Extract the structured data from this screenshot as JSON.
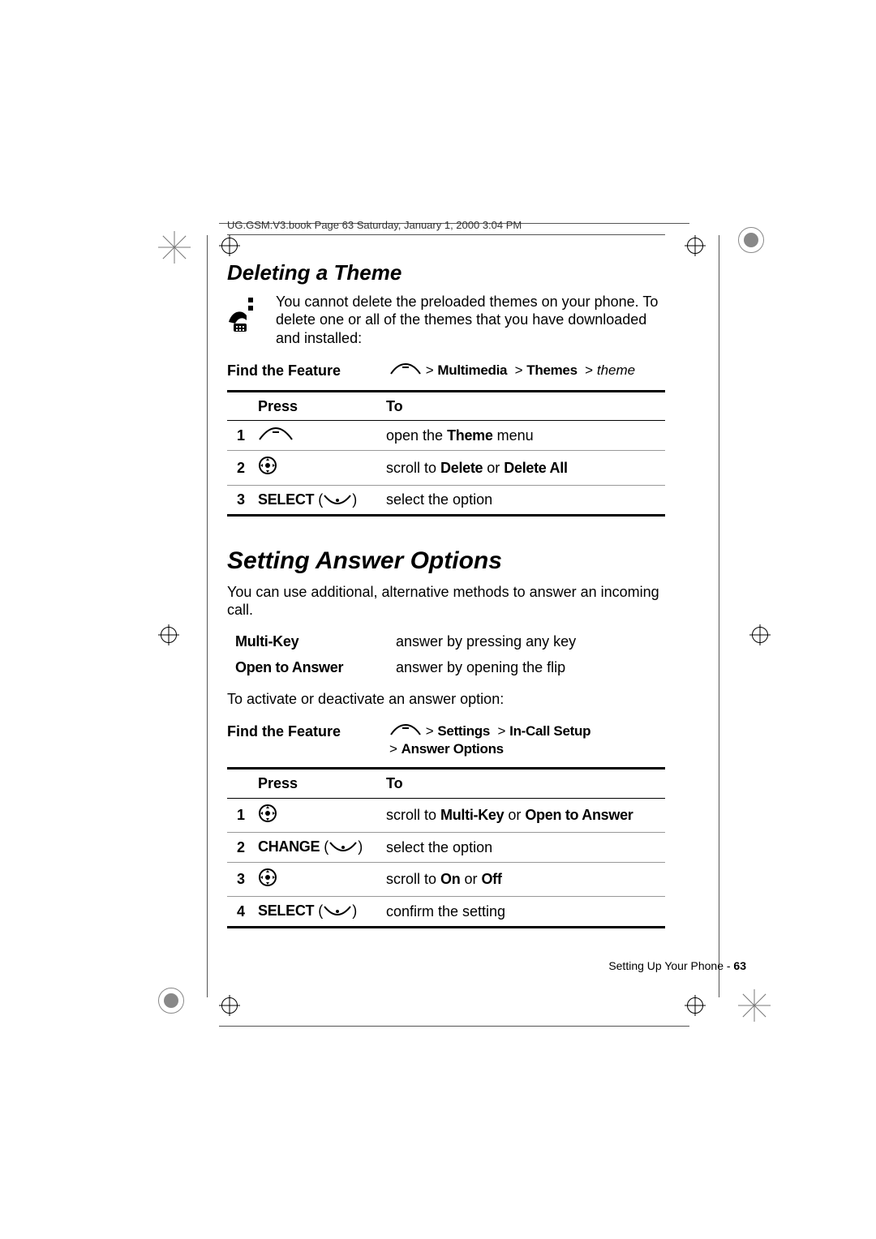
{
  "header": "UG.GSM.V3.book  Page 63  Saturday, January 1, 2000  3:04 PM",
  "section1": {
    "title": "Deleting a Theme",
    "intro": "You cannot delete the preloaded themes on your phone. To delete one or all of the themes that you have downloaded and installed:",
    "feature_label": "Find the Feature",
    "path_parts": {
      "a": "Multimedia",
      "b": "Themes",
      "c": "theme"
    },
    "table": {
      "head_press": "Press",
      "head_to": "To",
      "rows": [
        {
          "n": "1",
          "press_icon": "menu",
          "to_pre": "open the ",
          "to_b": "Theme",
          "to_post": " menu"
        },
        {
          "n": "2",
          "press_icon": "nav",
          "to_pre": "scroll to ",
          "to_b": "Delete",
          "to_mid": " or ",
          "to_b2": "Delete All",
          "to_post": ""
        },
        {
          "n": "3",
          "press_label": "SELECT",
          "press_icon": "softkey",
          "to_pre": "select the option",
          "to_b": "",
          "to_post": ""
        }
      ]
    }
  },
  "section2": {
    "title": "Setting Answer Options",
    "intro": "You can use additional, alternative methods to answer an incoming call.",
    "options": [
      {
        "name": "Multi-Key",
        "desc": "answer by pressing any key"
      },
      {
        "name": "Open to Answer",
        "desc": "answer by opening the flip"
      }
    ],
    "activate": "To activate or deactivate an answer option:",
    "feature_label": "Find the Feature",
    "path_parts": {
      "a": "Settings",
      "b": "In-Call Setup",
      "c": "Answer Options"
    },
    "table": {
      "head_press": "Press",
      "head_to": "To",
      "rows": [
        {
          "n": "1",
          "press_icon": "nav",
          "to_pre": "scroll to ",
          "to_b": "Multi-Key",
          "to_mid": " or ",
          "to_b2": "Open to Answer"
        },
        {
          "n": "2",
          "press_label": "CHANGE",
          "press_icon": "softkey",
          "to_pre": "select the option"
        },
        {
          "n": "3",
          "press_icon": "nav",
          "to_pre": "scroll to ",
          "to_b": "On",
          "to_mid": " or ",
          "to_b2": "Off"
        },
        {
          "n": "4",
          "press_label": "SELECT",
          "press_icon": "softkey",
          "to_pre": "confirm the setting"
        }
      ]
    }
  },
  "footer": {
    "text": "Setting Up Your Phone - ",
    "page": "63"
  }
}
